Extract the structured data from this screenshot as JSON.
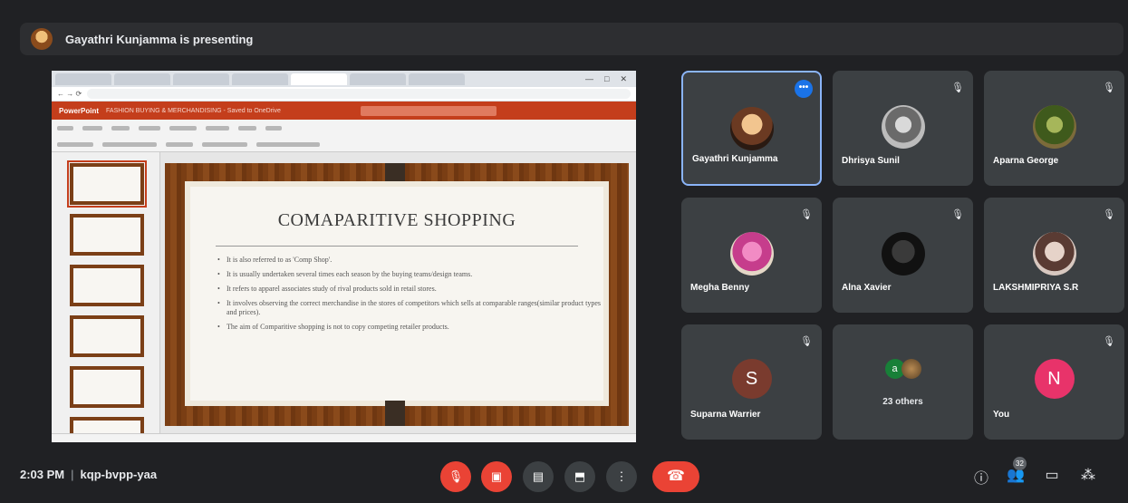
{
  "banner": {
    "text": "Gayathri Kunjamma is presenting"
  },
  "slide": {
    "title": "COMAPARITIVE SHOPPING",
    "bullets": [
      "It is also referred to as 'Comp Shop'.",
      "It is usually undertaken several times each season by the buying teams/design teams.",
      "It refers to apparel associates study of rival products sold in retail stores.",
      "It involves observing the correct merchandise in the stores of competitors which sells at comparable ranges(similar product types and prices).",
      "The aim of Comparitive shopping is not to copy competing retailer products."
    ]
  },
  "ppt": {
    "brand": "PowerPoint",
    "doc": "FASHION BUYING & MERCHANDISING - Saved to OneDrive"
  },
  "participants": [
    {
      "name": "Gayathri Kunjamma",
      "active": true
    },
    {
      "name": "Dhrisya Sunil"
    },
    {
      "name": "Aparna George"
    },
    {
      "name": "Megha Benny"
    },
    {
      "name": "Alna Xavier"
    },
    {
      "name": "LAKSHMIPRIYA S.R"
    },
    {
      "name": "Suparna Warrier",
      "initial": "S"
    },
    {
      "name": "23 others",
      "initial": "a"
    },
    {
      "name": "You",
      "initial": "N"
    }
  ],
  "colors": {
    "suparna": "#7a3b2e",
    "you": "#e8336a",
    "accent": "#8ab4f8",
    "danger": "#ea4335"
  },
  "footer": {
    "time": "2:03 PM",
    "code": "kqp-bvpp-yaa",
    "people_count": "32"
  }
}
